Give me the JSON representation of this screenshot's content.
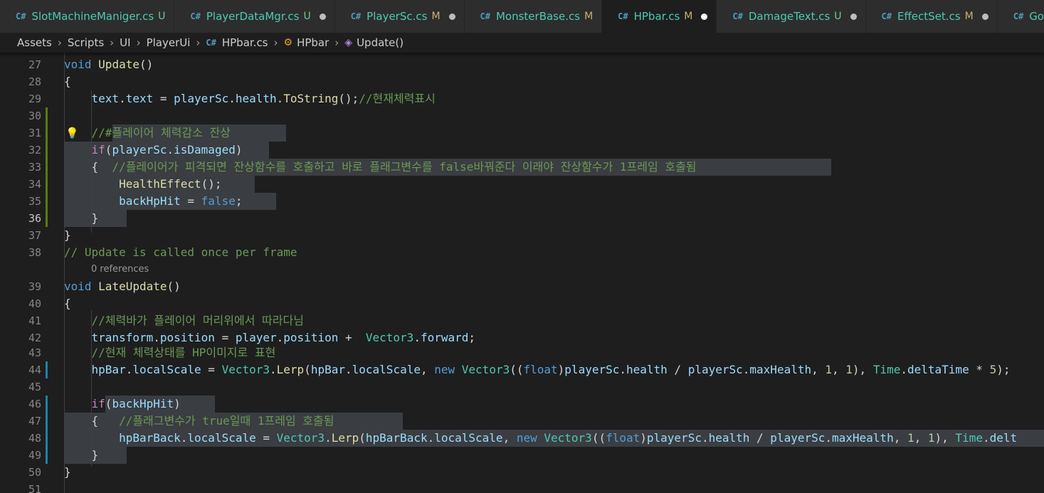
{
  "tabs": [
    {
      "name": "SlotMachineManiger.cs",
      "status": "U",
      "dirty": false,
      "active": false
    },
    {
      "name": "PlayerDataMgr.cs",
      "status": "U",
      "dirty": true,
      "active": false
    },
    {
      "name": "PlayerSc.cs",
      "status": "M",
      "dirty": true,
      "active": false
    },
    {
      "name": "MonsterBase.cs",
      "status": "M",
      "dirty": false,
      "active": false
    },
    {
      "name": "HPbar.cs",
      "status": "M",
      "dirty": true,
      "active": true
    },
    {
      "name": "DamageText.cs",
      "status": "U",
      "dirty": true,
      "active": false
    },
    {
      "name": "EffectSet.cs",
      "status": "M",
      "dirty": true,
      "active": false
    },
    {
      "name": "Gold",
      "status": "",
      "dirty": false,
      "active": false
    }
  ],
  "breadcrumb": {
    "items": [
      "Assets",
      "Scripts",
      "UI",
      "PlayerUi"
    ],
    "file": "HPbar.cs",
    "class_name": "HPbar",
    "method": "Update()"
  },
  "references_labels": {
    "late_update": "0 references"
  },
  "lines": [
    {
      "n": "27",
      "segs": [
        [
          "kw",
          "void"
        ],
        [
          "t",
          " "
        ],
        [
          "fn",
          "Update"
        ],
        [
          "t",
          "()"
        ]
      ]
    },
    {
      "n": "28",
      "segs": [
        [
          "t",
          "{"
        ]
      ]
    },
    {
      "n": "29",
      "segs": [
        [
          "t",
          "    "
        ],
        [
          "va",
          "text"
        ],
        [
          "t",
          "."
        ],
        [
          "va",
          "text"
        ],
        [
          "t",
          " = "
        ],
        [
          "va",
          "playerSc"
        ],
        [
          "t",
          "."
        ],
        [
          "va",
          "health"
        ],
        [
          "t",
          "."
        ],
        [
          "fn",
          "ToString"
        ],
        [
          "t",
          "();"
        ],
        [
          "cm",
          "//현재체력표시"
        ]
      ]
    },
    {
      "n": "30",
      "segs": []
    },
    {
      "n": "31",
      "segs": [
        [
          "t",
          "    "
        ],
        [
          "cm",
          "//#플레이어 체력감소 잔상"
        ]
      ]
    },
    {
      "n": "32",
      "segs": [
        [
          "t",
          "    "
        ],
        [
          "ctl",
          "if"
        ],
        [
          "t",
          "("
        ],
        [
          "va",
          "playerSc"
        ],
        [
          "t",
          "."
        ],
        [
          "va",
          "isDamaged"
        ],
        [
          "t",
          ")"
        ]
      ]
    },
    {
      "n": "33",
      "segs": [
        [
          "t",
          "    {  "
        ],
        [
          "cm",
          "//플레이어가 피격되면 잔상함수를 호출하고 바로 플래그변수를 false바꿔준다 이래야 잔상함수가 1프레임 호출됨"
        ]
      ]
    },
    {
      "n": "34",
      "segs": [
        [
          "t",
          "        "
        ],
        [
          "fn",
          "HealthEffect"
        ],
        [
          "t",
          "();"
        ]
      ]
    },
    {
      "n": "35",
      "segs": [
        [
          "t",
          "        "
        ],
        [
          "va",
          "backHpHit"
        ],
        [
          "t",
          " = "
        ],
        [
          "kw",
          "false"
        ],
        [
          "t",
          ";"
        ]
      ]
    },
    {
      "n": "36",
      "segs": [
        [
          "t",
          "    }"
        ]
      ]
    },
    {
      "n": "37",
      "segs": [
        [
          "t",
          "}"
        ]
      ]
    },
    {
      "n": "38",
      "segs": [
        [
          "cm",
          "// Update is called once per frame"
        ]
      ]
    },
    {
      "n": "39",
      "segs": [
        [
          "kw",
          "void"
        ],
        [
          "t",
          " "
        ],
        [
          "fn",
          "LateUpdate"
        ],
        [
          "t",
          "()"
        ]
      ]
    },
    {
      "n": "40",
      "segs": [
        [
          "t",
          "{"
        ]
      ]
    },
    {
      "n": "41",
      "segs": [
        [
          "t",
          "    "
        ],
        [
          "cm",
          "//체력바가 플레이어 머리위에서 따라다님"
        ]
      ]
    },
    {
      "n": "42",
      "segs": [
        [
          "t",
          "    "
        ],
        [
          "va",
          "transform"
        ],
        [
          "t",
          "."
        ],
        [
          "va",
          "position"
        ],
        [
          "t",
          " = "
        ],
        [
          "va",
          "player"
        ],
        [
          "t",
          "."
        ],
        [
          "va",
          "position"
        ],
        [
          "t",
          " +  "
        ],
        [
          "ty",
          "Vector3"
        ],
        [
          "t",
          "."
        ],
        [
          "va",
          "forward"
        ],
        [
          "t",
          ";"
        ]
      ]
    },
    {
      "n": "43",
      "segs": [
        [
          "t",
          "    "
        ],
        [
          "cm",
          "//현재 체력상태를 HP이미지로 표현"
        ]
      ]
    },
    {
      "n": "44",
      "segs": [
        [
          "t",
          "    "
        ],
        [
          "va",
          "hpBar"
        ],
        [
          "t",
          "."
        ],
        [
          "va",
          "localScale"
        ],
        [
          "t",
          " = "
        ],
        [
          "ty",
          "Vector3"
        ],
        [
          "t",
          "."
        ],
        [
          "fn",
          "Lerp"
        ],
        [
          "t",
          "("
        ],
        [
          "va",
          "hpBar"
        ],
        [
          "t",
          "."
        ],
        [
          "va",
          "localScale"
        ],
        [
          "t",
          ", "
        ],
        [
          "kw",
          "new"
        ],
        [
          "t",
          " "
        ],
        [
          "ty",
          "Vector3"
        ],
        [
          "t",
          "(("
        ],
        [
          "kw",
          "float"
        ],
        [
          "t",
          ")"
        ],
        [
          "va",
          "playerSc"
        ],
        [
          "t",
          "."
        ],
        [
          "va",
          "health"
        ],
        [
          "t",
          " / "
        ],
        [
          "va",
          "playerSc"
        ],
        [
          "t",
          "."
        ],
        [
          "va",
          "maxHealth"
        ],
        [
          "t",
          ", "
        ],
        [
          "nm",
          "1"
        ],
        [
          "t",
          ", "
        ],
        [
          "nm",
          "1"
        ],
        [
          "t",
          "), "
        ],
        [
          "ty",
          "Time"
        ],
        [
          "t",
          "."
        ],
        [
          "va",
          "deltaTime"
        ],
        [
          "t",
          " * "
        ],
        [
          "nm",
          "5"
        ],
        [
          "t",
          ");"
        ]
      ]
    },
    {
      "n": "45",
      "segs": []
    },
    {
      "n": "46",
      "segs": [
        [
          "t",
          "    "
        ],
        [
          "ctl",
          "if"
        ],
        [
          "t",
          "("
        ],
        [
          "va",
          "backHpHit"
        ],
        [
          "t",
          ")"
        ]
      ]
    },
    {
      "n": "47",
      "segs": [
        [
          "t",
          "    {   "
        ],
        [
          "cm",
          "//플래그변수가 true일때 1프레임 호출됨"
        ]
      ]
    },
    {
      "n": "48",
      "segs": [
        [
          "t",
          "        "
        ],
        [
          "va",
          "hpBarBack"
        ],
        [
          "t",
          "."
        ],
        [
          "va",
          "localScale"
        ],
        [
          "t",
          " = "
        ],
        [
          "ty",
          "Vector3"
        ],
        [
          "t",
          "."
        ],
        [
          "fn",
          "Lerp"
        ],
        [
          "t",
          "("
        ],
        [
          "va",
          "hpBarBack"
        ],
        [
          "t",
          "."
        ],
        [
          "va",
          "localScale"
        ],
        [
          "t",
          ", "
        ],
        [
          "kw",
          "new"
        ],
        [
          "t",
          " "
        ],
        [
          "ty",
          "Vector3"
        ],
        [
          "t",
          "(("
        ],
        [
          "kw",
          "float"
        ],
        [
          "t",
          ")"
        ],
        [
          "va",
          "playerSc"
        ],
        [
          "t",
          "."
        ],
        [
          "va",
          "health"
        ],
        [
          "t",
          " / "
        ],
        [
          "va",
          "playerSc"
        ],
        [
          "t",
          "."
        ],
        [
          "va",
          "maxHealth"
        ],
        [
          "t",
          ", "
        ],
        [
          "nm",
          "1"
        ],
        [
          "t",
          ", "
        ],
        [
          "nm",
          "1"
        ],
        [
          "t",
          "), "
        ],
        [
          "ty",
          "Time"
        ],
        [
          "t",
          "."
        ],
        [
          "va",
          "delt"
        ]
      ]
    },
    {
      "n": "49",
      "segs": [
        [
          "t",
          "    }"
        ]
      ]
    },
    {
      "n": "50",
      "segs": [
        [
          "t",
          "}"
        ]
      ]
    },
    {
      "n": "51",
      "segs": []
    }
  ],
  "current_line": "36",
  "colors": {
    "accent": "#4ec9b0",
    "comment": "#6a9955",
    "keyword": "#569cd6"
  }
}
